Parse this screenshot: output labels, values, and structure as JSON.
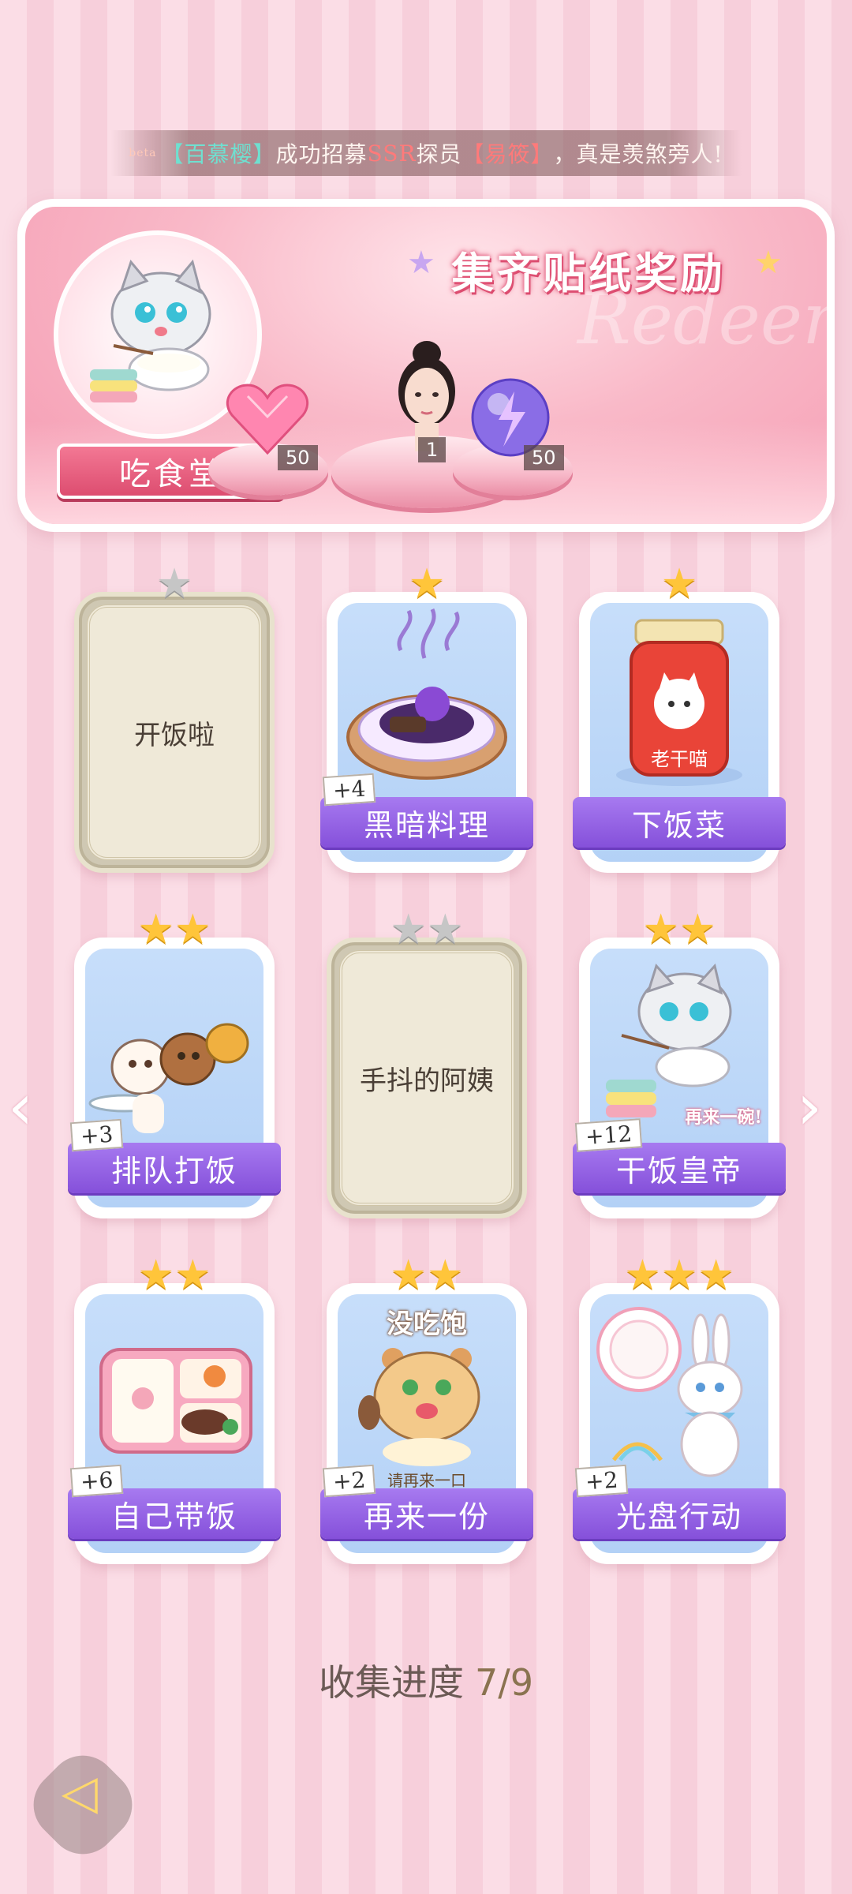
{
  "notice": {
    "prefix": "beta",
    "name1": "【百慕樱】",
    "mid1": "成功招募",
    "rarity": "SSR",
    "mid2": "探员",
    "name2": "【易筱】",
    "suffix": "，真是羡煞旁人!"
  },
  "banner": {
    "title": "集齐贴纸奖励",
    "ghost": "Redeem",
    "canteen": "吃食堂",
    "cat_bubble": "再来一碗!",
    "rewards": [
      {
        "icon": "pink-heart-gem-icon",
        "count": "50"
      },
      {
        "icon": "character-portrait",
        "count": "1"
      },
      {
        "icon": "purple-energy-orb-icon",
        "count": "50"
      }
    ]
  },
  "cards": [
    {
      "name": "开饭啦",
      "locked": true,
      "stars": 1,
      "plus": ""
    },
    {
      "name": "黑暗料理",
      "locked": false,
      "stars": 1,
      "plus": "+4"
    },
    {
      "name": "下饭菜",
      "locked": false,
      "stars": 1,
      "plus": "",
      "jar_label": "老干喵"
    },
    {
      "name": "排队打饭",
      "locked": false,
      "stars": 2,
      "plus": "+3"
    },
    {
      "name": "手抖的阿姨",
      "locked": true,
      "stars": 2,
      "plus": ""
    },
    {
      "name": "干饭皇帝",
      "locked": false,
      "stars": 2,
      "plus": "+12",
      "bubble": "再来一碗!"
    },
    {
      "name": "自己带饭",
      "locked": false,
      "stars": 2,
      "plus": "+6"
    },
    {
      "name": "再来一份",
      "locked": false,
      "stars": 2,
      "plus": "+2",
      "top_text": "没吃饱",
      "bib_text": "请再来一口"
    },
    {
      "name": "光盘行动",
      "locked": false,
      "stars": 3,
      "plus": "+2"
    }
  ],
  "progress": {
    "label": "收集进度",
    "value": "7/9"
  },
  "nav": {
    "prev": "‹",
    "next": "›",
    "back_icon": "back-arrow-icon"
  }
}
